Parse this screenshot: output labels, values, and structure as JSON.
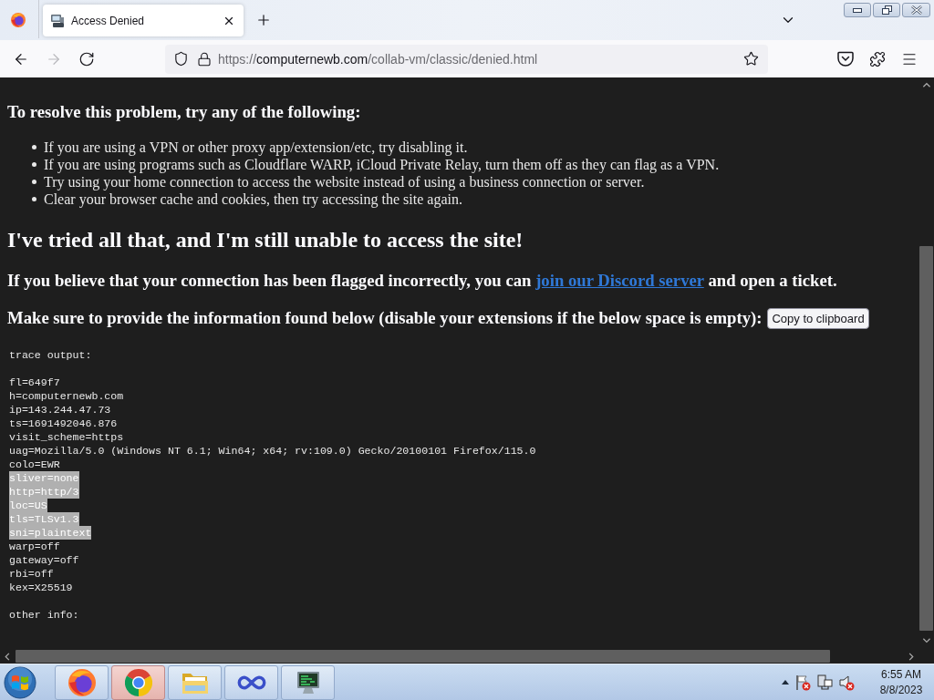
{
  "browser": {
    "tabs": [
      {
        "title": "Access Denied",
        "selected": true
      }
    ],
    "nav_buttons": [
      {
        "kind": "back",
        "disabled": false
      },
      {
        "kind": "forward",
        "disabled": true
      },
      {
        "kind": "reload",
        "disabled": false
      }
    ],
    "url": {
      "scheme": "https://",
      "host": "computernewb.com",
      "path": "/collab-vm/classic/denied.html"
    }
  },
  "page": {
    "heading": "To resolve this problem, try any of the following:",
    "tips": [
      "If you are using a VPN or other proxy app/extension/etc, try disabling it.",
      "If you are using programs such as Cloudflare WARP, iCloud Private Relay, turn them off as they can flag as a VPN.",
      "Try using your home connection to access the website instead of using a business connection or server.",
      "Clear your browser cache and cookies, then try accessing the site again."
    ],
    "subheading": "I've tried all that, and I'm still unable to access the site!",
    "contact": {
      "before": "If you believe that your connection has been flagged incorrectly, you can",
      "link": "join our Discord server",
      "after": "and open a ticket."
    },
    "instructions": "Make sure to provide the information found below (disable your extensions if the below space is empty):",
    "copy_button": "Copy to clipboard",
    "trace_title": "trace output:",
    "trace_lines": [
      {
        "text": "fl=649f7",
        "selected": false
      },
      {
        "text": "h=computernewb.com",
        "selected": false
      },
      {
        "text": "ip=143.244.47.73",
        "selected": false
      },
      {
        "text": "ts=1691492046.876",
        "selected": false
      },
      {
        "text": "visit_scheme=https",
        "selected": false
      },
      {
        "text": "uag=Mozilla/5.0 (Windows NT 6.1; Win64; x64; rv:109.0) Gecko/20100101 Firefox/115.0",
        "selected": false
      },
      {
        "text": "colo=EWR",
        "selected": false
      },
      {
        "text": "sliver=none",
        "selected": true
      },
      {
        "text": "http=http/3",
        "selected": true
      },
      {
        "text": "loc=US",
        "selected": true
      },
      {
        "text": "tls=TLSv1.3",
        "selected": true
      },
      {
        "text": "sni=plaintext",
        "selected": true
      },
      {
        "text": "warp=off",
        "selected": false
      },
      {
        "text": "gateway=off",
        "selected": false
      },
      {
        "text": "rbi=off",
        "selected": false
      },
      {
        "text": "kex=X25519",
        "selected": false
      }
    ],
    "other_title": "other info:"
  },
  "taskbar": {
    "apps": [
      {
        "kind": "firefox",
        "active": false
      },
      {
        "kind": "chrome",
        "active": true
      },
      {
        "kind": "explorer",
        "active": false
      },
      {
        "kind": "infinity",
        "active": false
      },
      {
        "kind": "monitor",
        "active": false
      }
    ],
    "clock": {
      "time": "6:55 AM",
      "date": "8/8/2023"
    }
  }
}
